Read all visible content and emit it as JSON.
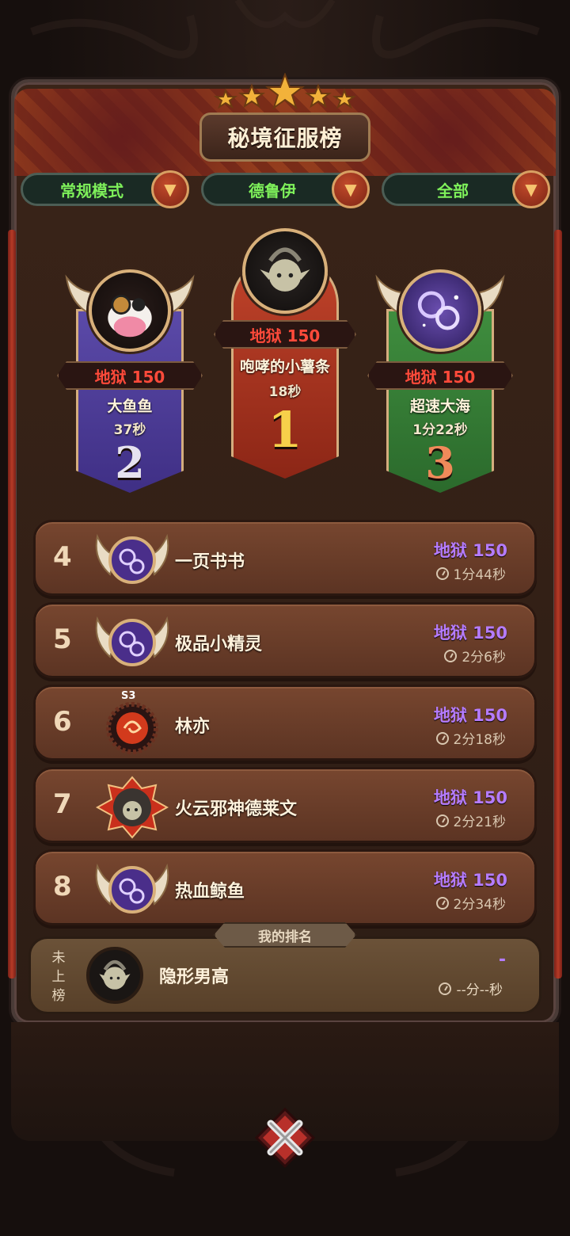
{
  "title": "秘境征服榜",
  "filters": [
    {
      "label": "常规模式"
    },
    {
      "label": "德鲁伊"
    },
    {
      "label": "全部"
    }
  ],
  "podium": {
    "first": {
      "rank": "1",
      "difficulty": "地狱 150",
      "name": "咆哮的小薯条",
      "time": "18秒"
    },
    "second": {
      "rank": "2",
      "difficulty": "地狱 150",
      "name": "大鱼鱼",
      "time": "37秒"
    },
    "third": {
      "rank": "3",
      "difficulty": "地狱 150",
      "name": "超速大海",
      "time": "1分22秒"
    }
  },
  "rows": [
    {
      "rank": "4",
      "name": "一页书书",
      "difficulty": "地狱 150",
      "time": "1分44秒"
    },
    {
      "rank": "5",
      "name": "极品小精灵",
      "difficulty": "地狱 150",
      "time": "2分6秒"
    },
    {
      "rank": "6",
      "name": "林亦",
      "difficulty": "地狱 150",
      "time": "2分18秒",
      "badge": "S3"
    },
    {
      "rank": "7",
      "name": "火云邪神德莱文",
      "difficulty": "地狱 150",
      "time": "2分21秒"
    },
    {
      "rank": "8",
      "name": "热血鲸鱼",
      "difficulty": "地狱 150",
      "time": "2分34秒"
    }
  ],
  "my_ranking": {
    "tab_label": "我的排名",
    "status": "未上榜",
    "name": "隐形男高",
    "difficulty": "-",
    "time": "--分--秒"
  },
  "icons": {
    "close": "close-x-icon",
    "dropdown": "triangle-down-icon",
    "clock": "clock-icon"
  },
  "colors": {
    "difficulty_purple": "#b57cff",
    "filter_green": "#7ef05a",
    "podium_hell_red": "#ff4a3a"
  }
}
